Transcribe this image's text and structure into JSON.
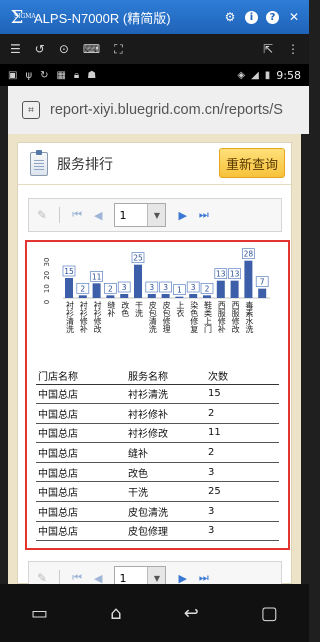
{
  "window": {
    "title": "ALPS-N7000R (精简版)",
    "logo": "Σ",
    "logo_small": "SIGMA"
  },
  "titlebar_icons": [
    "gear-icon",
    "info-icon",
    "help-icon",
    "close-icon"
  ],
  "status": {
    "time": "9:58"
  },
  "browser": {
    "url": "report-xiyi.bluegrid.com.cn/reports/S"
  },
  "panel": {
    "title": "服务排行",
    "refresh_label": "重新查询"
  },
  "pager": {
    "page": "1"
  },
  "chart_data": {
    "type": "bar",
    "categories": [
      "衬衫清洗",
      "衬衫修补",
      "衬衫修改",
      "缝补",
      "改色",
      "干洗",
      "皮包清洗",
      "皮包修理",
      "上衣",
      "染色修复",
      "鞋类上门",
      "西服修补",
      "西服修改",
      "毒素水洗"
    ],
    "values": [
      15,
      2,
      11,
      2,
      3,
      25,
      3,
      3,
      1,
      3,
      2,
      13,
      13,
      28,
      7
    ],
    "ylim": [
      0,
      30
    ],
    "yticks": [
      "30",
      "20",
      "10",
      "0"
    ],
    "color": "#3d5ea8"
  },
  "table": {
    "headers": [
      "门店名称",
      "服务名称",
      "次数"
    ],
    "rows": [
      [
        "中国总店",
        "衬衫清洗",
        "15"
      ],
      [
        "中国总店",
        "衬衫修补",
        "2"
      ],
      [
        "中国总店",
        "衬衫修改",
        "11"
      ],
      [
        "中国总店",
        "缝补",
        "2"
      ],
      [
        "中国总店",
        "改色",
        "3"
      ],
      [
        "中国总店",
        "干洗",
        "25"
      ],
      [
        "中国总店",
        "皮包清洗",
        "3"
      ],
      [
        "中国总店",
        "皮包修理",
        "3"
      ]
    ]
  }
}
